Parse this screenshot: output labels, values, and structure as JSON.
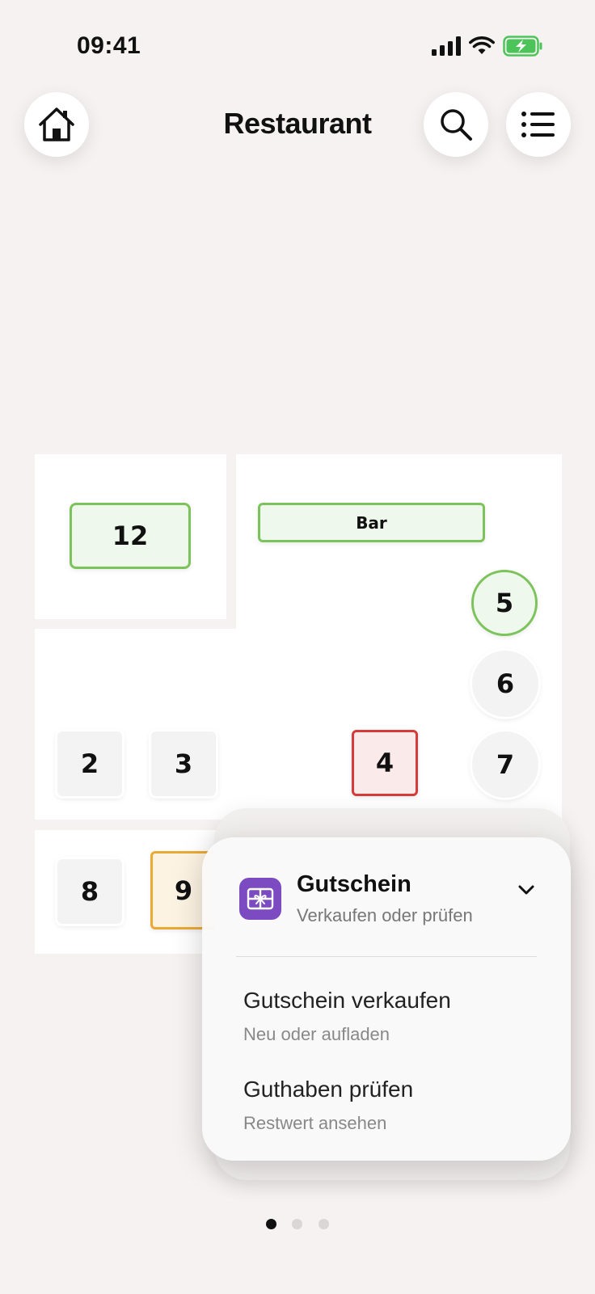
{
  "status": {
    "time": "09:41"
  },
  "header": {
    "title": "Restaurant"
  },
  "floorplan": {
    "tables": {
      "t12": "12",
      "bar": "Bar",
      "t5": "5",
      "t6": "6",
      "t2": "2",
      "t3": "3",
      "t4": "4",
      "t7": "7",
      "t8": "8",
      "t9": "9"
    },
    "colors": {
      "free": "#7dc35b",
      "occupied": "#d63a3a",
      "reserved": "#eba935"
    }
  },
  "popup": {
    "title": "Gutschein",
    "subtitle": "Verkaufen oder prüfen",
    "options": [
      {
        "title": "Gutschein verkaufen",
        "subtitle": "Neu oder aufladen"
      },
      {
        "title": "Guthaben prüfen",
        "subtitle": "Restwert ansehen"
      }
    ],
    "accent": "#7c4bc2"
  },
  "pagination": {
    "pages": 3,
    "current": 1
  }
}
